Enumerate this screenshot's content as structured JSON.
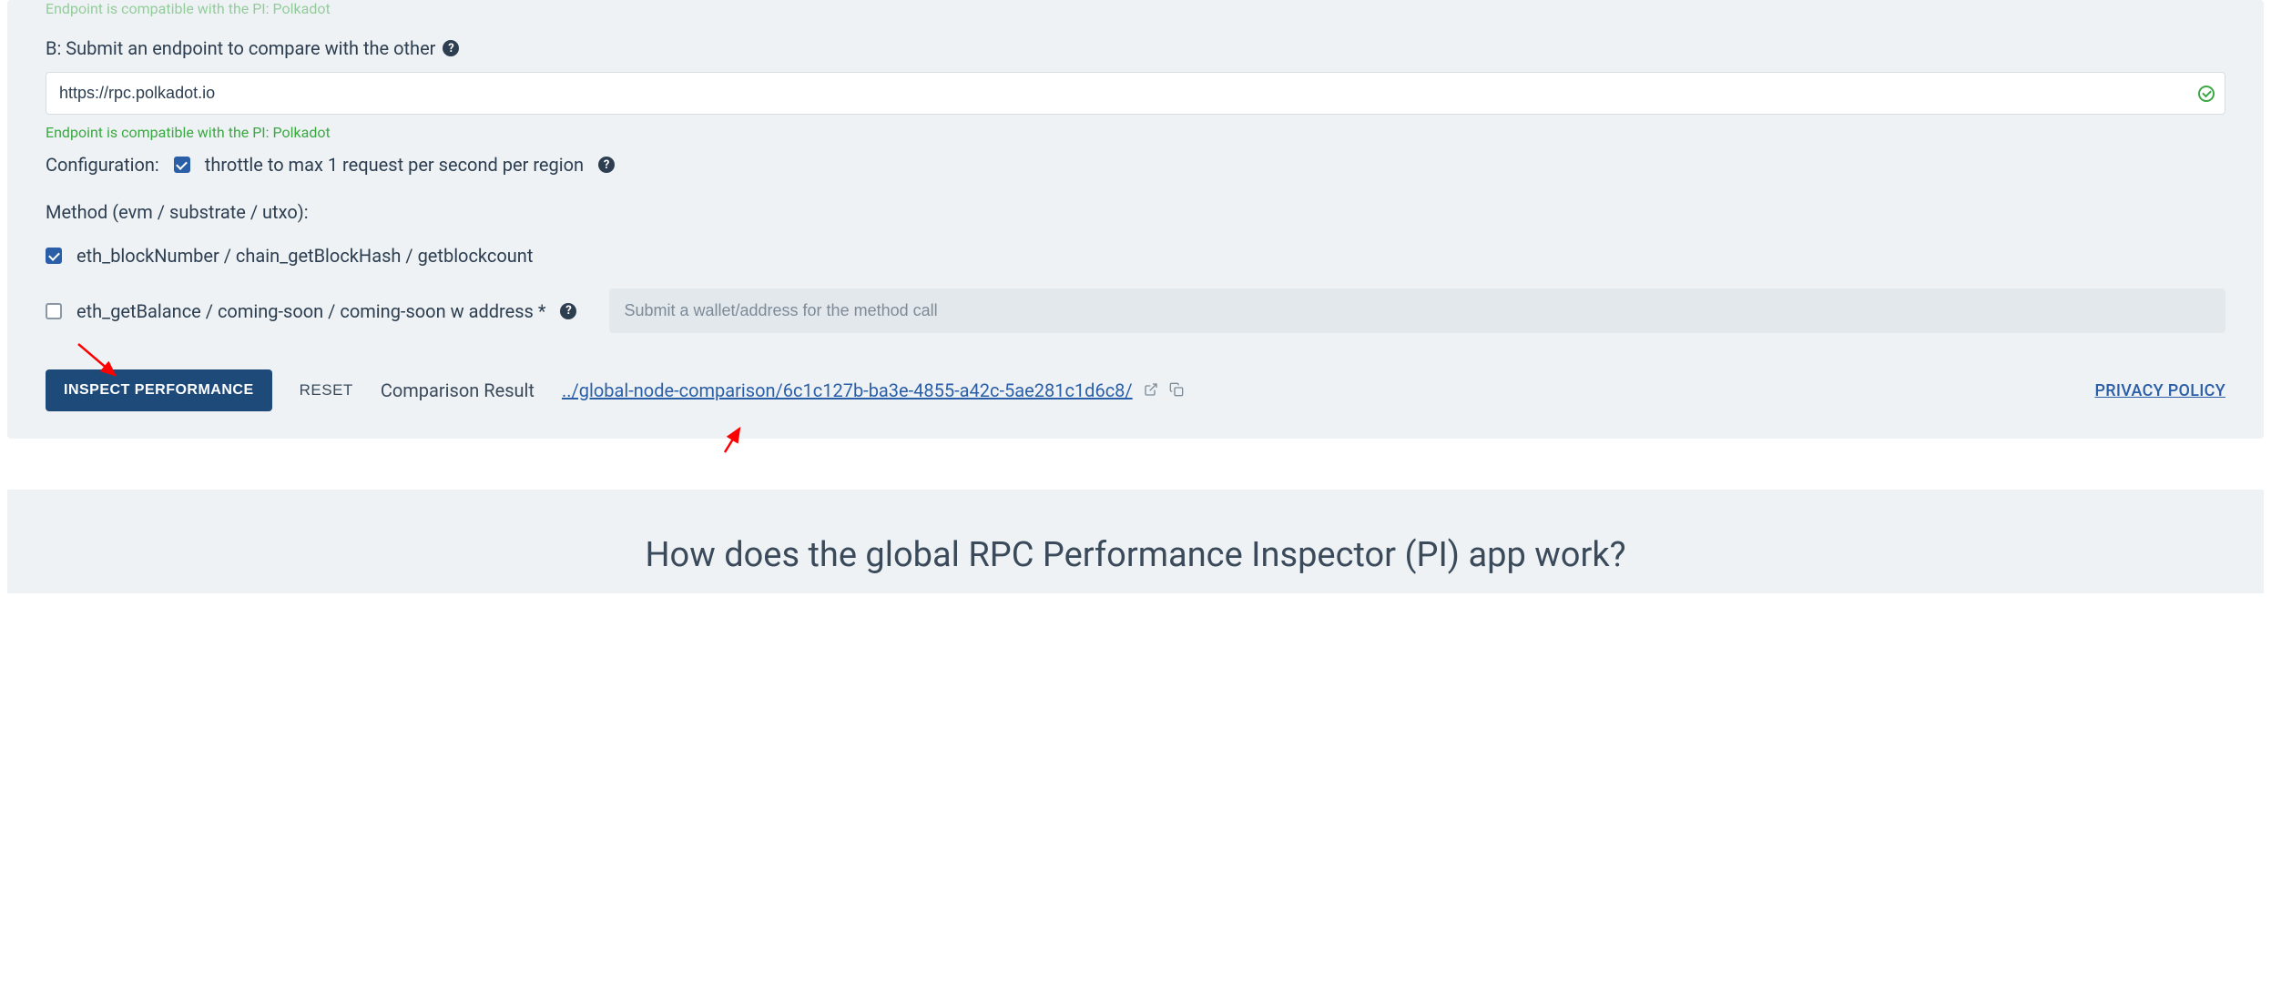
{
  "endpointA": {
    "status": "Endpoint is compatible with the PI: Polkadot"
  },
  "endpointB": {
    "label": "B: Submit an endpoint to compare with the other",
    "value": "https://rpc.polkadot.io",
    "status": "Endpoint is compatible with the PI: Polkadot"
  },
  "configuration": {
    "label": "Configuration:",
    "throttle_label": "throttle to max 1 request per second per region"
  },
  "method": {
    "heading": "Method (evm / substrate / utxo):",
    "option1": "eth_blockNumber / chain_getBlockHash / getblockcount",
    "option2": "eth_getBalance / coming-soon / coming-soon w address *",
    "wallet_placeholder": "Submit a wallet/address for the method call"
  },
  "actions": {
    "inspect": "INSPECT PERFORMANCE",
    "reset": "RESET",
    "result_label": "Comparison Result",
    "result_link": "../global-node-comparison/6c1c127b-ba3e-4855-a42c-5ae281c1d6c8/",
    "privacy": "PRIVACY POLICY"
  },
  "heading": "How does the global RPC Performance Inspector (PI) app work?"
}
